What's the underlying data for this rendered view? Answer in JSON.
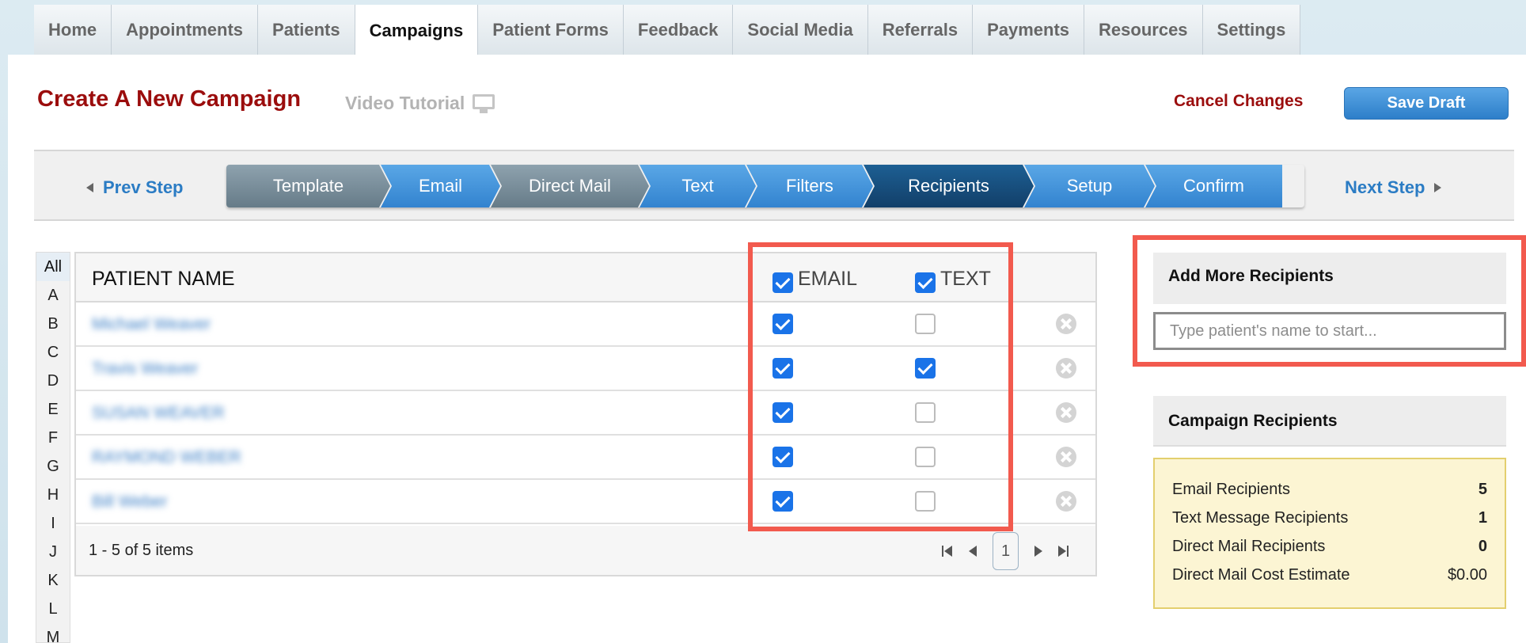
{
  "tabs": [
    "Home",
    "Appointments",
    "Patients",
    "Campaigns",
    "Patient Forms",
    "Feedback",
    "Social Media",
    "Referrals",
    "Payments",
    "Resources",
    "Settings"
  ],
  "header": {
    "title": "Create A New Campaign",
    "video_tutorial": "Video Tutorial",
    "cancel": "Cancel Changes",
    "save_draft": "Save Draft"
  },
  "stepbar": {
    "prev": "Prev Step",
    "next": "Next Step",
    "steps": [
      "Template",
      "Email",
      "Direct Mail",
      "Text",
      "Filters",
      "Recipients",
      "Setup",
      "Confirm"
    ]
  },
  "alphabet": [
    "All",
    "A",
    "B",
    "C",
    "D",
    "E",
    "F",
    "G",
    "H",
    "I",
    "J",
    "K",
    "L",
    "M"
  ],
  "grid": {
    "col_name": "PATIENT NAME",
    "col_email": "EMAIL",
    "col_text": "TEXT",
    "rows": [
      {
        "name": "Michael Weaver",
        "email": true,
        "text": false
      },
      {
        "name": "Travis Weaver",
        "email": true,
        "text": true
      },
      {
        "name": "SUSAN WEAVER",
        "email": true,
        "text": false
      },
      {
        "name": "RAYMOND WEBER",
        "email": true,
        "text": false
      },
      {
        "name": "Bill Weber",
        "email": true,
        "text": false
      }
    ],
    "page_info": "1 - 5 of 5 items",
    "page_number": "1"
  },
  "add_recipients": {
    "heading": "Add More Recipients",
    "placeholder": "Type patient's name to start..."
  },
  "campaign_recipients": {
    "heading": "Campaign Recipients",
    "email_label": "Email Recipients",
    "email_value": "5",
    "text_label": "Text Message Recipients",
    "text_value": "1",
    "mail_label": "Direct Mail Recipients",
    "mail_value": "0",
    "cost_label": "Direct Mail Cost Estimate",
    "cost_value": "$0.00"
  }
}
